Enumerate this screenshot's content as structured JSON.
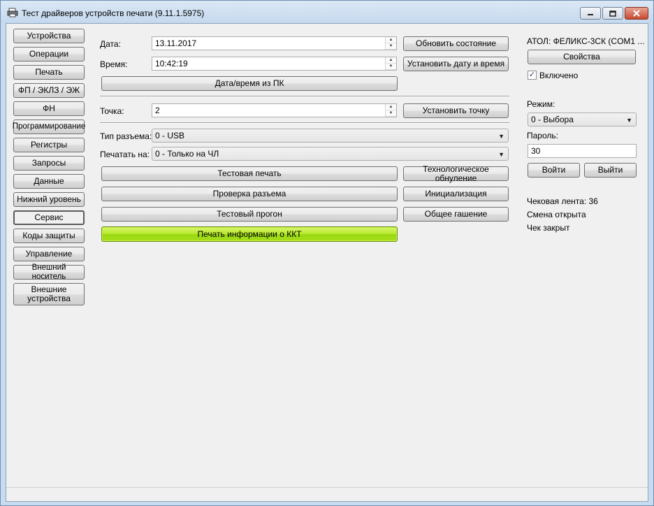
{
  "window": {
    "title": "Тест драйверов устройств печати (9.11.1.5975)"
  },
  "sidebar": {
    "items": [
      {
        "label": "Устройства"
      },
      {
        "label": "Операции"
      },
      {
        "label": "Печать"
      },
      {
        "label": "ФП / ЭКЛЗ / ЭЖ"
      },
      {
        "label": "ФН"
      },
      {
        "label": "Программирование"
      },
      {
        "label": "Регистры"
      },
      {
        "label": "Запросы"
      },
      {
        "label": "Данные"
      },
      {
        "label": "Нижний уровень"
      },
      {
        "label": "Сервис"
      },
      {
        "label": "Коды защиты"
      },
      {
        "label": "Управление"
      },
      {
        "label": "Внешний носитель"
      },
      {
        "label": "Внешние устройства"
      }
    ],
    "selected": "Сервис"
  },
  "main": {
    "date_label": "Дата:",
    "date_value": "13.11.2017",
    "time_label": "Время:",
    "time_value": "10:42:19",
    "pc_datetime_button": "Дата/время из ПК",
    "refresh_button": "Обновить состояние",
    "set_datetime_button": "Установить дату и время",
    "point_label": "Точка:",
    "point_value": "2",
    "set_point_button": "Установить точку",
    "connector_label": "Тип разъема:",
    "connector_value": "0 - USB",
    "print_on_label": "Печатать на:",
    "print_on_value": "0 - Только на ЧЛ",
    "test_print_button": "Тестовая печать",
    "tech_reset_button": "Технологическое обнуление",
    "check_connector_button": "Проверка разъема",
    "init_button": "Инициализация",
    "test_run_button": "Тестовый прогон",
    "general_cancel_button": "Общее гашение",
    "print_kkt_info_button": "Печать информации о ККТ"
  },
  "right_panel": {
    "device_name": "АТОЛ: ФЕЛИКС-3СК (COM1 ...",
    "properties_button": "Свойства",
    "enabled_label": "Включено",
    "enabled_checked": true,
    "mode_label": "Режим:",
    "mode_value": "0 - Выбора",
    "password_label": "Пароль:",
    "password_value": "30",
    "login_button": "Войти",
    "logout_button": "Выйти",
    "receipt_tape": "Чековая лента: 36",
    "shift_status": "Смена открыта",
    "check_status": "Чек закрыт"
  }
}
